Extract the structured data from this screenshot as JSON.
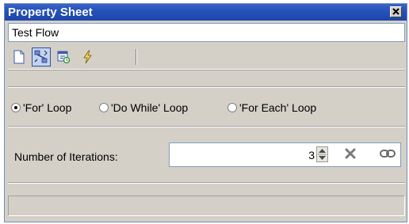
{
  "window": {
    "title": "Property Sheet",
    "close_icon": "close-icon"
  },
  "object_name": "Test Flow",
  "toolbar": {
    "buttons": [
      {
        "icon": "new-document-icon",
        "active": false
      },
      {
        "icon": "flow-properties-icon",
        "active": true
      },
      {
        "icon": "refresh-properties-icon",
        "active": false
      },
      {
        "icon": "lightning-icon",
        "active": false
      }
    ]
  },
  "loop_type": {
    "options": [
      "'For' Loop",
      "'Do While' Loop",
      "'For Each' Loop"
    ],
    "selected": "'For' Loop"
  },
  "iterations": {
    "label": "Number of Iterations:",
    "value": "3",
    "spin_icon": "spin-icon",
    "clear_icon": "clear-icon",
    "link_icon": "link-icon"
  },
  "colors": {
    "titlebar": "#2451b8",
    "panel": "#d4d0c8"
  }
}
